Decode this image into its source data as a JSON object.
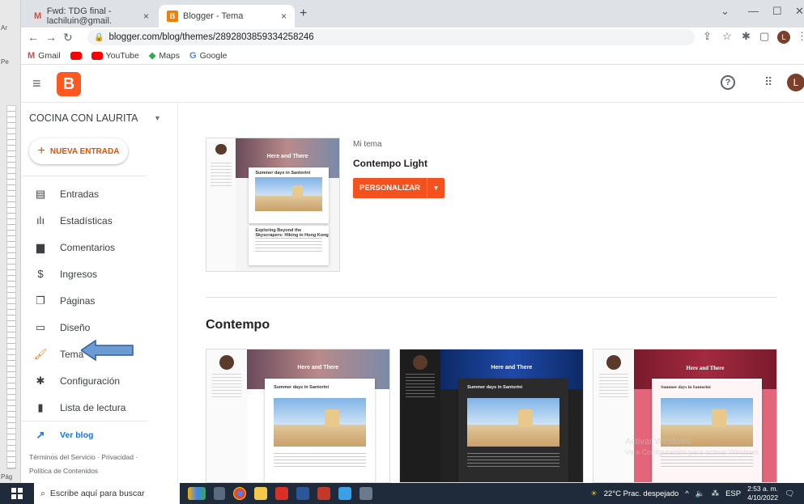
{
  "underlying": {
    "label_a": "Ar",
    "label_pe": "Pe",
    "label_pag": "Pág"
  },
  "browser": {
    "tabs": [
      {
        "label": "Fwd: TDG final - lachiluin@gmail.",
        "close": "×"
      },
      {
        "label": "Blogger - Tema",
        "close": "×"
      }
    ],
    "new_tab": "+",
    "url": "blogger.com/blog/themes/2892803859334258246",
    "profile_initial": "L",
    "bookmarks": [
      {
        "label": "Gmail",
        "icon": "gmail-icon"
      },
      {
        "label": "YouTube",
        "icon": "youtube-icon"
      },
      {
        "label": "Maps",
        "icon": "maps-icon"
      },
      {
        "label": "Google",
        "icon": "google-icon"
      }
    ]
  },
  "header": {
    "logo_letter": "B",
    "help": "?",
    "avatar_initial": "L"
  },
  "sidebar": {
    "blog_name": "COCINA CON LAURITA",
    "new_post": "NUEVA ENTRADA",
    "items": [
      {
        "label": "Entradas",
        "icon": "posts-icon",
        "glyph": "▤"
      },
      {
        "label": "Estadísticas",
        "icon": "stats-icon",
        "glyph": "ılı"
      },
      {
        "label": "Comentarios",
        "icon": "comments-icon",
        "glyph": "▆"
      },
      {
        "label": "Ingresos",
        "icon": "earnings-icon",
        "glyph": "$"
      },
      {
        "label": "Páginas",
        "icon": "pages-icon",
        "glyph": "❐"
      },
      {
        "label": "Diseño",
        "icon": "layout-icon",
        "glyph": "▭"
      },
      {
        "label": "Tema",
        "icon": "theme-icon",
        "glyph": "🖌"
      },
      {
        "label": "Configuración",
        "icon": "settings-icon",
        "glyph": "✱"
      },
      {
        "label": "Lista de lectura",
        "icon": "reading-list-icon",
        "glyph": "▮"
      }
    ],
    "view_blog": "Ver blog",
    "footer_1": "Términos del Servicio · Privacidad ·",
    "footer_2": "Política de Contenidos"
  },
  "main": {
    "my_theme_label": "Mi tema",
    "my_theme_name": "Contempo Light",
    "customize": "PERSONALIZAR",
    "section_title": "Contempo",
    "preview_blog_title": "Here and There",
    "preview_post_title": "Summer days in Santorini",
    "preview_post_2": "Exploring Beyond the Skyscrapers: Hiking in Hong Kong"
  },
  "taskbar": {
    "search_placeholder": "Escribe aquí para buscar",
    "weather": "22°C  Prac. despejado",
    "lang": "ESP",
    "time": "2:53 a. m.",
    "date": "4/10/2022"
  },
  "watermark": {
    "line1": "Activar Windows",
    "line2": "Ve a Configuración para activar Windows."
  }
}
